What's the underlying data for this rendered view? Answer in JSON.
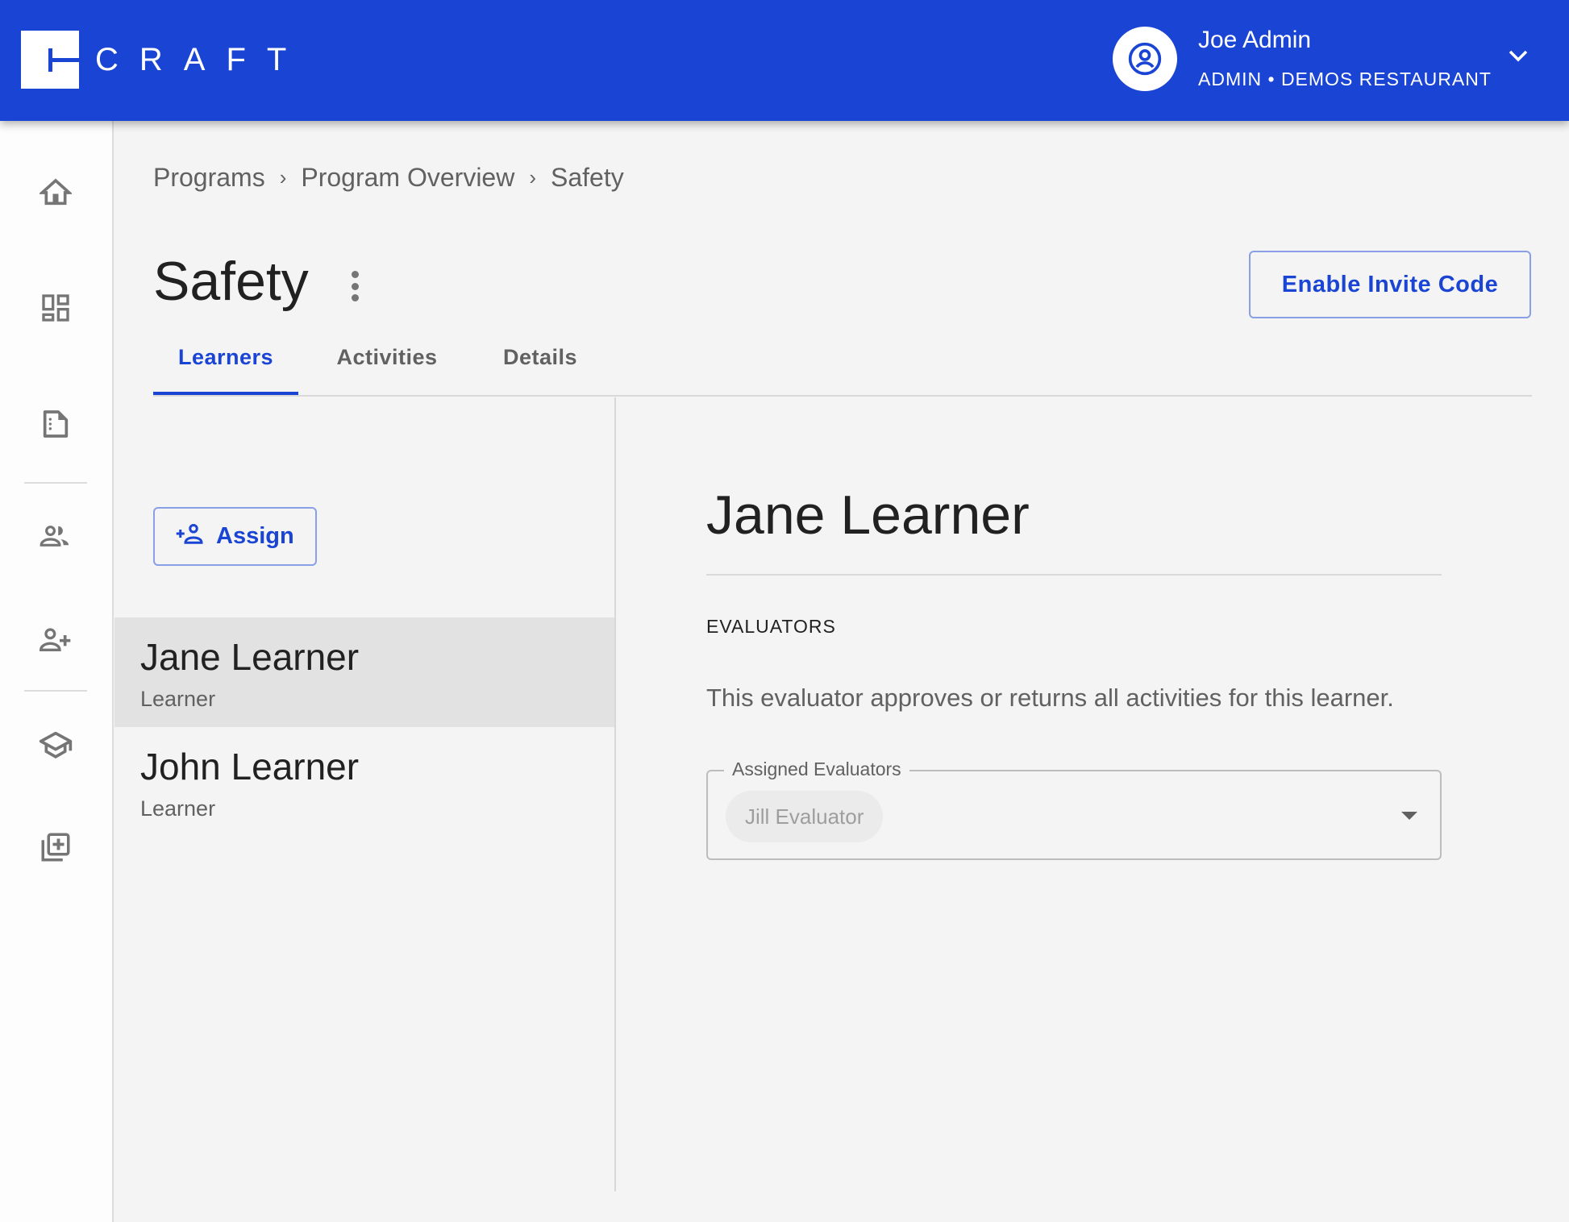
{
  "header": {
    "logo_text": "CRAFT",
    "user_name": "Joe Admin",
    "user_role": "ADMIN • DEMOS RESTAURANT",
    "brand_color": "#1a44d4"
  },
  "sidebar": {
    "items": [
      {
        "icon": "home-icon",
        "label": "Home"
      },
      {
        "icon": "dashboard-icon",
        "label": "Dashboard"
      },
      {
        "icon": "document-icon",
        "label": "Documents"
      },
      {
        "icon": "people-icon",
        "label": "People"
      },
      {
        "icon": "add-person-icon",
        "label": "Add Person"
      },
      {
        "icon": "school-icon",
        "label": "Programs"
      },
      {
        "icon": "library-add-icon",
        "label": "Add Content"
      }
    ]
  },
  "breadcrumb": {
    "items": [
      "Programs",
      "Program Overview",
      "Safety"
    ],
    "separator": "›"
  },
  "page": {
    "title": "Safety",
    "invite_button": "Enable Invite Code"
  },
  "tabs": [
    {
      "label": "Learners",
      "active": true
    },
    {
      "label": "Activities",
      "active": false
    },
    {
      "label": "Details",
      "active": false
    }
  ],
  "learners": {
    "assign_button": "Assign",
    "items": [
      {
        "name": "Jane Learner",
        "role": "Learner",
        "selected": true
      },
      {
        "name": "John Learner",
        "role": "Learner",
        "selected": false
      }
    ]
  },
  "detail": {
    "name": "Jane Learner",
    "section_label": "EVALUATORS",
    "help_text": "This evaluator approves or returns all activities for this learner.",
    "field_label": "Assigned Evaluators",
    "selected_evaluators": [
      "Jill Evaluator"
    ]
  }
}
